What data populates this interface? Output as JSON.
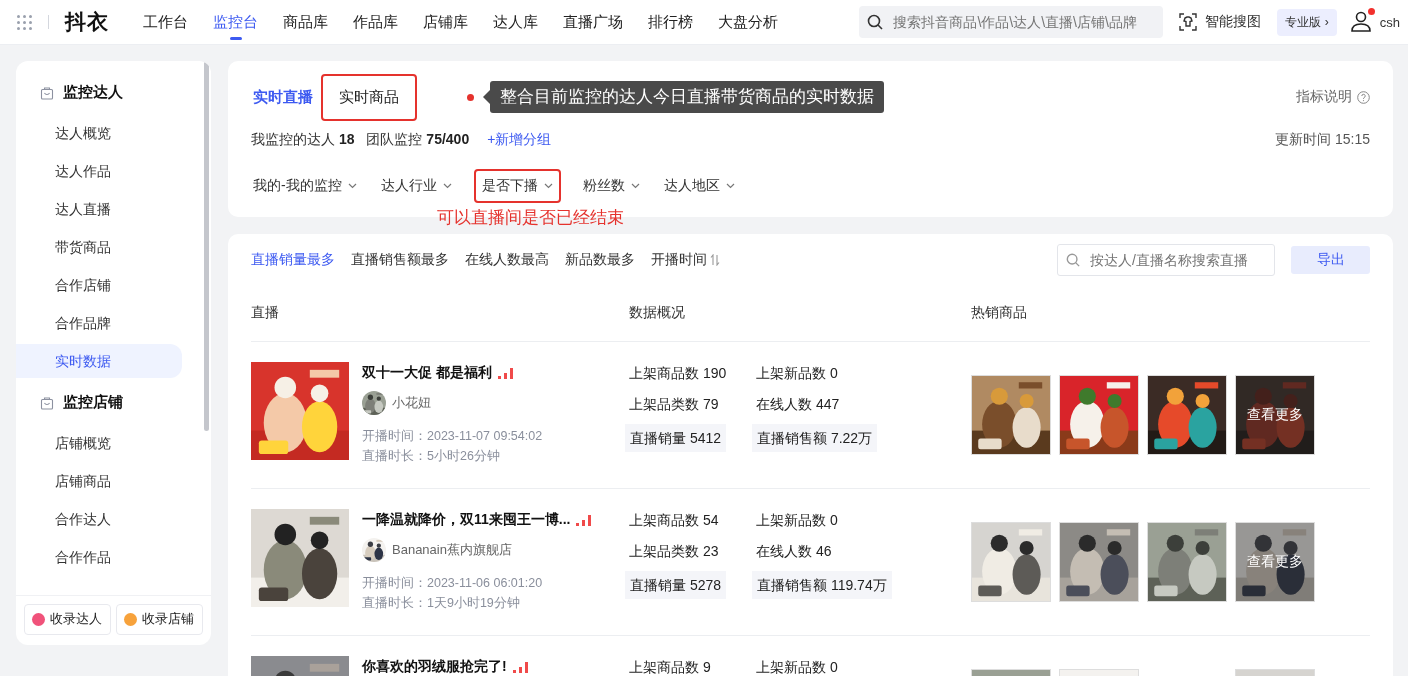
{
  "header": {
    "logo": "抖衣",
    "nav": [
      {
        "label": "工作台",
        "selected": false
      },
      {
        "label": "监控台",
        "selected": true
      },
      {
        "label": "商品库",
        "selected": false
      },
      {
        "label": "作品库",
        "selected": false
      },
      {
        "label": "店铺库",
        "selected": false
      },
      {
        "label": "达人库",
        "selected": false
      },
      {
        "label": "直播广场",
        "selected": false
      },
      {
        "label": "排行榜",
        "selected": false
      },
      {
        "label": "大盘分析",
        "selected": false
      }
    ],
    "search": {
      "placeholder": "搜索抖音商品\\作品\\达人\\直播\\店铺\\品牌"
    },
    "image_search": "智能搜图",
    "plan": "专业版 ›",
    "user": "csh",
    "notification": true
  },
  "sidebar": {
    "groups": [
      {
        "title": "监控达人",
        "items": [
          {
            "label": "达人概览",
            "selected": false
          },
          {
            "label": "达人作品",
            "selected": false
          },
          {
            "label": "达人直播",
            "selected": false
          },
          {
            "label": "带货商品",
            "selected": false
          },
          {
            "label": "合作店铺",
            "selected": false
          },
          {
            "label": "合作品牌",
            "selected": false
          },
          {
            "label": "实时数据",
            "selected": true
          }
        ]
      },
      {
        "title": "监控店铺",
        "items": [
          {
            "label": "店铺概览",
            "selected": false
          },
          {
            "label": "店铺商品",
            "selected": false
          },
          {
            "label": "合作达人",
            "selected": false
          },
          {
            "label": "合作作品",
            "selected": false
          }
        ]
      }
    ],
    "buttons": [
      {
        "label": "收录达人",
        "color": "#f0527a"
      },
      {
        "label": "收录店铺",
        "color": "#f7a23b"
      }
    ]
  },
  "summary": {
    "tabs": [
      {
        "label": "实时直播",
        "selected": true,
        "highlighted": false
      },
      {
        "label": "实时商品",
        "selected": false,
        "highlighted": true
      }
    ],
    "tooltip": "整合目前监控的达人今日直播带货商品的实时数据",
    "help": "指标说明",
    "stats": [
      {
        "label": "我监控的达人",
        "value": "18"
      },
      {
        "label": "团队监控",
        "value": "75/400"
      }
    ],
    "add_group": "+新增分组",
    "updated": "更新时间 15:15",
    "filters": [
      {
        "label": "我的-我的监控",
        "highlighted": false
      },
      {
        "label": "达人行业",
        "highlighted": false
      },
      {
        "label": "是否下播",
        "highlighted": true,
        "note": "可以直播间是否已经结束"
      },
      {
        "label": "粉丝数",
        "highlighted": false
      },
      {
        "label": "达人地区",
        "highlighted": false
      }
    ]
  },
  "list": {
    "sorts": [
      {
        "label": "直播销量最多",
        "selected": true,
        "sortable": false
      },
      {
        "label": "直播销售额最多",
        "selected": false,
        "sortable": false
      },
      {
        "label": "在线人数最高",
        "selected": false,
        "sortable": false
      },
      {
        "label": "新品数最多",
        "selected": false,
        "sortable": false
      },
      {
        "label": "开播时间",
        "selected": false,
        "sortable": true
      }
    ],
    "search": {
      "placeholder": "按达人/直播名称搜索直播"
    },
    "export": "导出",
    "columns": [
      "直播",
      "数据概况",
      "热销商品"
    ],
    "rows": [
      {
        "title": "双十一大促 都是福利",
        "author": "小花妞",
        "start": "开播时间：2023-11-07 09:54:02",
        "duration": "直播时长：5小时26分钟",
        "stats": [
          {
            "label": "上架商品数 190",
            "kind": "plain"
          },
          {
            "label": "上架新品数 0",
            "kind": "plain"
          },
          {
            "label": "上架品类数 79",
            "kind": "plain"
          },
          {
            "label": "在线人数 447",
            "kind": "plain"
          },
          {
            "label": "直播销量 5412",
            "kind": "boxed"
          },
          {
            "label": "直播销售额 7.22万",
            "kind": "boxed"
          }
        ],
        "products": [
          {
            "kind": "picture"
          },
          {
            "kind": "picture"
          },
          {
            "kind": "picture"
          },
          {
            "kind": "more",
            "label": "查看更多"
          }
        ]
      },
      {
        "title": "一降温就降价，双11来囤王一博...",
        "author": "Bananain蕉内旗舰店",
        "start": "开播时间：2023-11-06 06:01:20",
        "duration": "直播时长：1天9小时19分钟",
        "stats": [
          {
            "label": "上架商品数 54",
            "kind": "plain"
          },
          {
            "label": "上架新品数 0",
            "kind": "plain"
          },
          {
            "label": "上架品类数 23",
            "kind": "plain"
          },
          {
            "label": "在线人数 46",
            "kind": "plain"
          },
          {
            "label": "直播销量 5278",
            "kind": "boxed"
          },
          {
            "label": "直播销售额 119.74万",
            "kind": "boxed"
          }
        ],
        "products": [
          {
            "kind": "picture"
          },
          {
            "kind": "picture"
          },
          {
            "kind": "picture"
          },
          {
            "kind": "more",
            "label": "查看更多"
          }
        ]
      },
      {
        "title": "你喜欢的羽绒服抢完了!",
        "stats": [
          {
            "label": "上架商品数 9",
            "kind": "plain"
          },
          {
            "label": "上架新品数 0",
            "kind": "plain"
          }
        ],
        "products": [
          {
            "kind": "picture"
          },
          {
            "kind": "picture"
          },
          {
            "kind": "blank"
          },
          {
            "kind": "picture"
          }
        ]
      }
    ]
  }
}
